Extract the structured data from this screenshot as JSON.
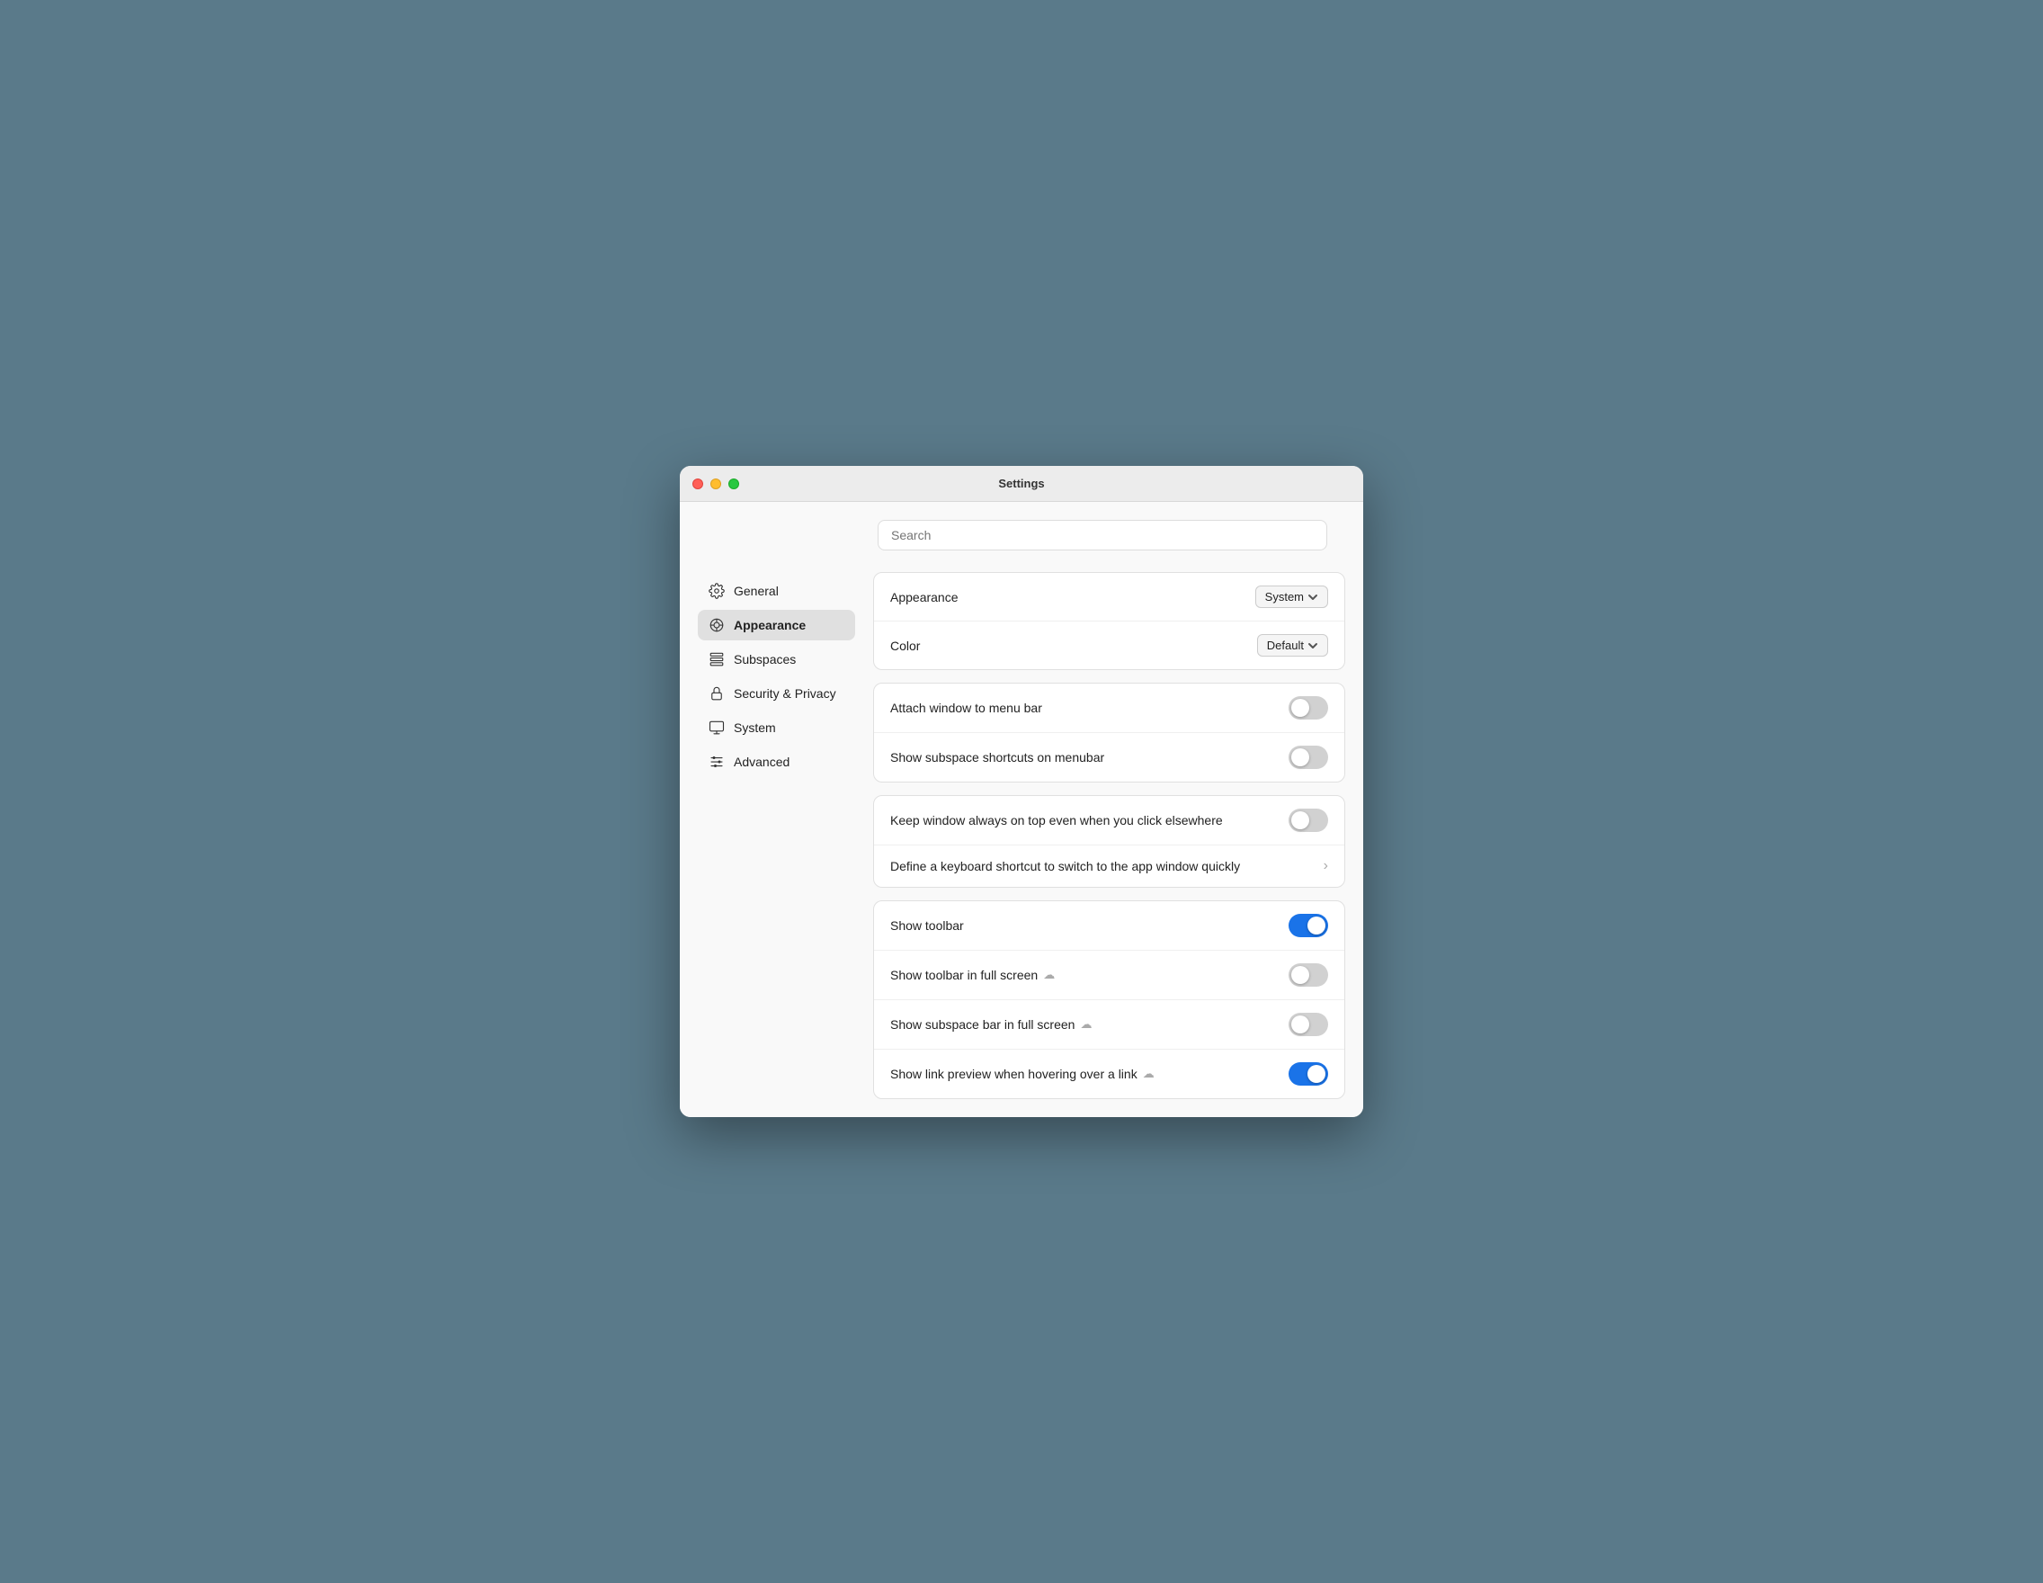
{
  "window": {
    "title": "Settings"
  },
  "search": {
    "placeholder": "Search"
  },
  "sidebar": {
    "items": [
      {
        "id": "general",
        "label": "General",
        "icon": "gear"
      },
      {
        "id": "appearance",
        "label": "Appearance",
        "icon": "appearance",
        "active": true
      },
      {
        "id": "subspaces",
        "label": "Subspaces",
        "icon": "subspaces"
      },
      {
        "id": "security-privacy",
        "label": "Security & Privacy",
        "icon": "lock"
      },
      {
        "id": "system",
        "label": "System",
        "icon": "monitor"
      },
      {
        "id": "advanced",
        "label": "Advanced",
        "icon": "sliders"
      }
    ]
  },
  "cards": [
    {
      "id": "appearance-card",
      "rows": [
        {
          "id": "appearance",
          "label": "Appearance",
          "control": "select",
          "value": "System"
        },
        {
          "id": "color",
          "label": "Color",
          "control": "select",
          "value": "Default"
        }
      ]
    },
    {
      "id": "window-card",
      "rows": [
        {
          "id": "attach-window",
          "label": "Attach window to menu bar",
          "control": "toggle",
          "state": "off"
        },
        {
          "id": "subspace-shortcuts",
          "label": "Show subspace shortcuts on menubar",
          "control": "toggle",
          "state": "off"
        }
      ]
    },
    {
      "id": "window-card2",
      "rows": [
        {
          "id": "always-on-top",
          "label": "Keep window always on top even when you click elsewhere",
          "control": "toggle",
          "state": "off"
        },
        {
          "id": "keyboard-shortcut",
          "label": "Define a keyboard shortcut to switch to the app window quickly",
          "control": "chevron"
        }
      ]
    },
    {
      "id": "toolbar-card",
      "rows": [
        {
          "id": "show-toolbar",
          "label": "Show toolbar",
          "control": "toggle",
          "state": "on",
          "cloud": false
        },
        {
          "id": "toolbar-fullscreen",
          "label": "Show toolbar in full screen",
          "control": "toggle",
          "state": "off",
          "cloud": true
        },
        {
          "id": "subspace-fullscreen",
          "label": "Show subspace bar in full screen",
          "control": "toggle",
          "state": "off",
          "cloud": true
        },
        {
          "id": "link-preview",
          "label": "Show link preview when hovering over a link",
          "control": "toggle",
          "state": "on",
          "cloud": true
        }
      ]
    }
  ],
  "colors": {
    "toggle_on": "#1a73e8",
    "toggle_off": "#d1d1d1"
  }
}
